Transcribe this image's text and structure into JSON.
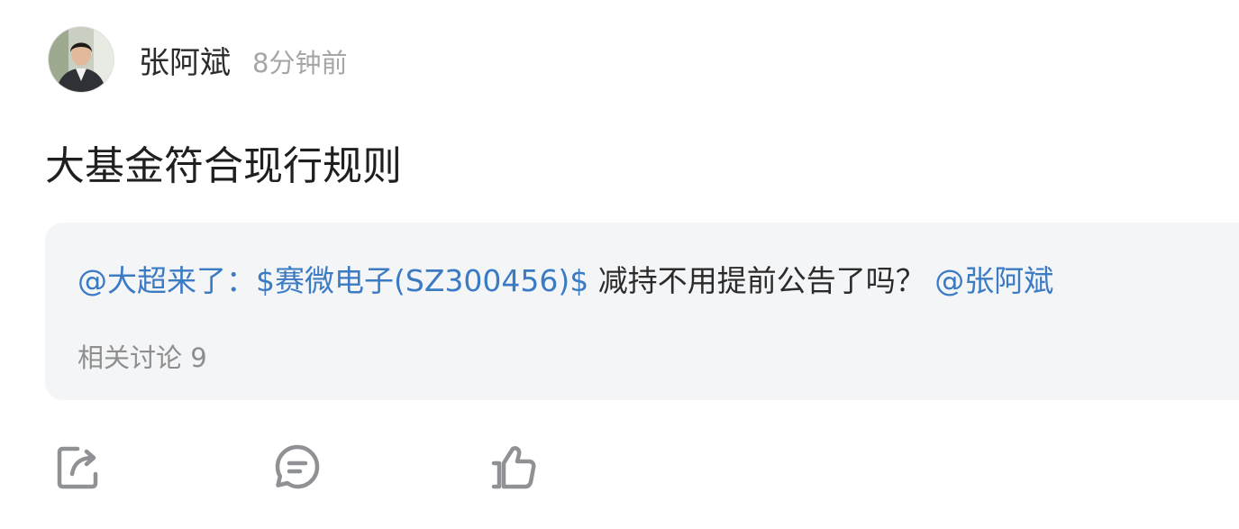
{
  "author": {
    "name": "张阿斌",
    "time": "8分钟前",
    "avatar_icon": "avatar-photo"
  },
  "post": {
    "text": "大基金符合现行规则"
  },
  "quote": {
    "mention": "@大超来了：",
    "stock": "$赛微电子(SZ300456)$",
    "text": " 减持不用提前公告了吗？",
    "trailing_mention": "@张阿斌",
    "related_label": "相关讨论 9"
  },
  "actions": [
    {
      "icon": "share-icon"
    },
    {
      "icon": "comment-icon"
    },
    {
      "icon": "like-icon"
    }
  ],
  "colors": {
    "link": "#3b7bc4",
    "muted": "#a6a6a6",
    "card_bg": "#f4f5f7",
    "icon": "#8f9194"
  }
}
